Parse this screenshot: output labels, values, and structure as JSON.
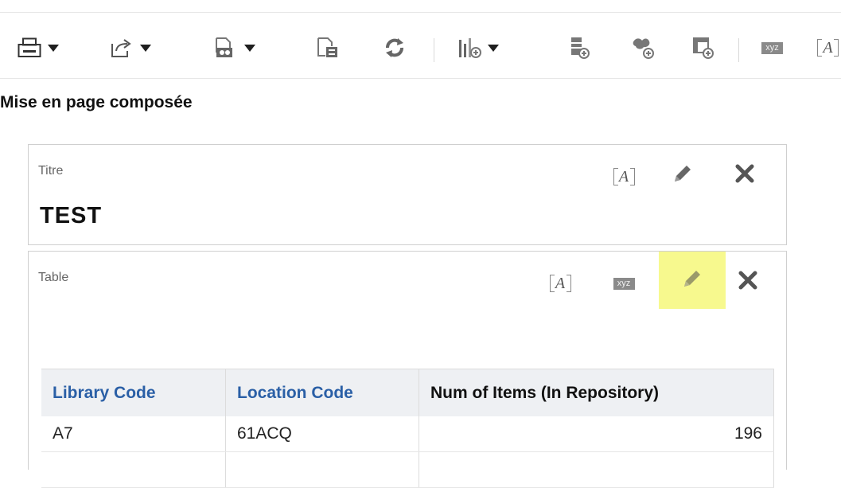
{
  "toolbar": {
    "items": [
      {
        "icon": "print-icon",
        "has_menu": true
      },
      {
        "icon": "export-icon",
        "has_menu": true
      },
      {
        "icon": "print-preview-icon",
        "has_menu": true
      },
      {
        "icon": "properties-icon",
        "has_menu": false
      },
      {
        "icon": "refresh-icon",
        "has_menu": false
      },
      {
        "icon": "new-view-icon",
        "has_menu": true
      },
      {
        "icon": "add-table-icon",
        "has_menu": false
      },
      {
        "icon": "add-map-icon",
        "has_menu": false
      },
      {
        "icon": "add-pivot-icon",
        "has_menu": false
      },
      {
        "icon": "xyz-icon",
        "has_menu": false
      },
      {
        "icon": "title-icon",
        "has_menu": false
      }
    ],
    "xyz_label": "xyz",
    "title_glyph": "A"
  },
  "section": {
    "title": "Mise en page composée"
  },
  "views": {
    "title_view": {
      "label": "Titre",
      "heading": "TEST",
      "a_glyph": "A"
    },
    "table_view": {
      "label": "Table",
      "a_glyph": "A",
      "xyz_label": "xyz",
      "highlight_color": "#f7f98e"
    }
  },
  "table": {
    "columns": [
      "Library Code",
      "Location Code",
      "Num of Items (In Repository)"
    ],
    "rows": [
      [
        "A7",
        "61ACQ",
        "196"
      ],
      [
        "",
        "",
        ""
      ]
    ]
  },
  "colors": {
    "header_link": "#2a5fa6",
    "header_bg": "#eef0f3",
    "highlight": "#f7f98e"
  }
}
